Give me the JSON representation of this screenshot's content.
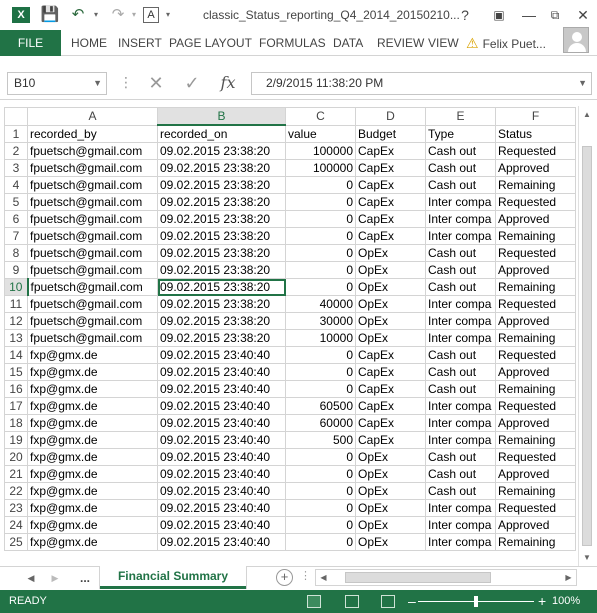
{
  "window": {
    "title": "classic_Status_reporting_Q4_2014_20150210...",
    "help": "?",
    "user_name": "Felix Puet..."
  },
  "quick_access": {
    "save_icon": "save-icon",
    "undo_icon": "undo-icon",
    "redo_icon": "redo-icon",
    "font_icon": "A"
  },
  "ribbon": {
    "tabs": [
      "FILE",
      "HOME",
      "INSERT",
      "PAGE LAYOUT",
      "FORMULAS",
      "DATA",
      "REVIEW",
      "VIEW"
    ]
  },
  "formula_bar": {
    "name_box": "B10",
    "fx": "fx",
    "formula": "2/9/2015  11:38:20 PM"
  },
  "columns": [
    "A",
    "B",
    "C",
    "D",
    "E",
    "F"
  ],
  "selected_column": "B",
  "selected_row": "10",
  "rows": [
    {
      "n": "1",
      "c": [
        "recorded_by",
        "recorded_on",
        "value",
        "Budget",
        "Type",
        "Status"
      ]
    },
    {
      "n": "2",
      "c": [
        "fpuetsch@gmail.com",
        "09.02.2015 23:38:20",
        "100000",
        "CapEx",
        "Cash out",
        "Requested"
      ]
    },
    {
      "n": "3",
      "c": [
        "fpuetsch@gmail.com",
        "09.02.2015 23:38:20",
        "100000",
        "CapEx",
        "Cash out",
        "Approved"
      ]
    },
    {
      "n": "4",
      "c": [
        "fpuetsch@gmail.com",
        "09.02.2015 23:38:20",
        "0",
        "CapEx",
        "Cash out",
        "Remaining"
      ]
    },
    {
      "n": "5",
      "c": [
        "fpuetsch@gmail.com",
        "09.02.2015 23:38:20",
        "0",
        "CapEx",
        "Inter compa",
        "Requested"
      ]
    },
    {
      "n": "6",
      "c": [
        "fpuetsch@gmail.com",
        "09.02.2015 23:38:20",
        "0",
        "CapEx",
        "Inter compa",
        "Approved"
      ]
    },
    {
      "n": "7",
      "c": [
        "fpuetsch@gmail.com",
        "09.02.2015 23:38:20",
        "0",
        "CapEx",
        "Inter compa",
        "Remaining"
      ]
    },
    {
      "n": "8",
      "c": [
        "fpuetsch@gmail.com",
        "09.02.2015 23:38:20",
        "0",
        "OpEx",
        "Cash out",
        "Requested"
      ]
    },
    {
      "n": "9",
      "c": [
        "fpuetsch@gmail.com",
        "09.02.2015 23:38:20",
        "0",
        "OpEx",
        "Cash out",
        "Approved"
      ]
    },
    {
      "n": "10",
      "c": [
        "fpuetsch@gmail.com",
        "09.02.2015 23:38:20",
        "0",
        "OpEx",
        "Cash out",
        "Remaining"
      ]
    },
    {
      "n": "11",
      "c": [
        "fpuetsch@gmail.com",
        "09.02.2015 23:38:20",
        "40000",
        "OpEx",
        "Inter compa",
        "Requested"
      ]
    },
    {
      "n": "12",
      "c": [
        "fpuetsch@gmail.com",
        "09.02.2015 23:38:20",
        "30000",
        "OpEx",
        "Inter compa",
        "Approved"
      ]
    },
    {
      "n": "13",
      "c": [
        "fpuetsch@gmail.com",
        "09.02.2015 23:38:20",
        "10000",
        "OpEx",
        "Inter compa",
        "Remaining"
      ]
    },
    {
      "n": "14",
      "c": [
        "fxp@gmx.de",
        "09.02.2015 23:40:40",
        "0",
        "CapEx",
        "Cash out",
        "Requested"
      ]
    },
    {
      "n": "15",
      "c": [
        "fxp@gmx.de",
        "09.02.2015 23:40:40",
        "0",
        "CapEx",
        "Cash out",
        "Approved"
      ]
    },
    {
      "n": "16",
      "c": [
        "fxp@gmx.de",
        "09.02.2015 23:40:40",
        "0",
        "CapEx",
        "Cash out",
        "Remaining"
      ]
    },
    {
      "n": "17",
      "c": [
        "fxp@gmx.de",
        "09.02.2015 23:40:40",
        "60500",
        "CapEx",
        "Inter compa",
        "Requested"
      ]
    },
    {
      "n": "18",
      "c": [
        "fxp@gmx.de",
        "09.02.2015 23:40:40",
        "60000",
        "CapEx",
        "Inter compa",
        "Approved"
      ]
    },
    {
      "n": "19",
      "c": [
        "fxp@gmx.de",
        "09.02.2015 23:40:40",
        "500",
        "CapEx",
        "Inter compa",
        "Remaining"
      ]
    },
    {
      "n": "20",
      "c": [
        "fxp@gmx.de",
        "09.02.2015 23:40:40",
        "0",
        "OpEx",
        "Cash out",
        "Requested"
      ]
    },
    {
      "n": "21",
      "c": [
        "fxp@gmx.de",
        "09.02.2015 23:40:40",
        "0",
        "OpEx",
        "Cash out",
        "Approved"
      ]
    },
    {
      "n": "22",
      "c": [
        "fxp@gmx.de",
        "09.02.2015 23:40:40",
        "0",
        "OpEx",
        "Cash out",
        "Remaining"
      ]
    },
    {
      "n": "23",
      "c": [
        "fxp@gmx.de",
        "09.02.2015 23:40:40",
        "0",
        "OpEx",
        "Inter compa",
        "Requested"
      ]
    },
    {
      "n": "24",
      "c": [
        "fxp@gmx.de",
        "09.02.2015 23:40:40",
        "0",
        "OpEx",
        "Inter compa",
        "Approved"
      ]
    },
    {
      "n": "25",
      "c": [
        "fxp@gmx.de",
        "09.02.2015 23:40:40",
        "0",
        "OpEx",
        "Inter compa",
        "Remaining"
      ]
    }
  ],
  "sheets": {
    "overflow": "...",
    "active": "Financial Summary"
  },
  "status": {
    "ready": "READY",
    "zoom": "100%"
  },
  "colors": {
    "accent": "#217346"
  }
}
